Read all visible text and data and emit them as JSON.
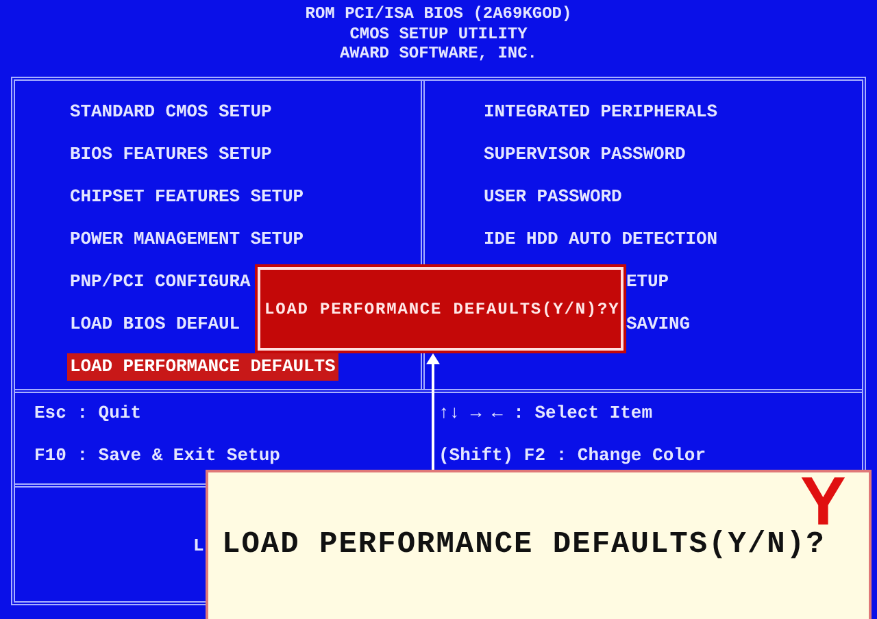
{
  "header": {
    "lines": [
      "ROM PCI/ISA BIOS (2A69KGOD)",
      "CMOS SETUP UTILITY",
      "AWARD SOFTWARE, INC."
    ]
  },
  "menu": {
    "left_items": [
      {
        "label": "STANDARD CMOS SETUP",
        "selected": false,
        "kind": "full"
      },
      {
        "label": "BIOS FEATURES SETUP",
        "selected": false,
        "kind": "full"
      },
      {
        "label": "CHIPSET FEATURES SETUP",
        "selected": false,
        "kind": "full"
      },
      {
        "label": "POWER MANAGEMENT SETUP",
        "selected": false,
        "kind": "full"
      },
      {
        "label": "PNP/PCI CONFIGURA",
        "selected": false,
        "kind": "full"
      },
      {
        "label": "LOAD BIOS DEFAUL",
        "selected": false,
        "kind": "full"
      },
      {
        "label": "LOAD PERFORMANCE DEFAULTS",
        "selected": true,
        "kind": "full"
      }
    ],
    "right_items": [
      {
        "label": "INTEGRATED PERIPHERALS",
        "selected": false,
        "kind": "full"
      },
      {
        "label": "SUPERVISOR PASSWORD",
        "selected": false,
        "kind": "full"
      },
      {
        "label": "USER PASSWORD",
        "selected": false,
        "kind": "full"
      },
      {
        "label": "IDE HDD AUTO DETECTION",
        "selected": false,
        "kind": "full"
      },
      {
        "label": "ETUP",
        "selected": false,
        "kind": "covered"
      },
      {
        "label": "SAVING",
        "selected": false,
        "kind": "covered"
      }
    ]
  },
  "footer": {
    "left": [
      "Esc : Quit",
      "F10 : Save & Exit Setup"
    ],
    "right": [
      "↑↓ → ← : Select Item",
      "(Shift) F2 : Change Color"
    ]
  },
  "status_line": "L",
  "dialog": {
    "message": "LOAD PERFORMANCE DEFAULTS(Y/N)?Y"
  },
  "callout": {
    "message": "LOAD PERFORMANCE DEFAULTS(Y/N)?",
    "answer": "Y"
  }
}
